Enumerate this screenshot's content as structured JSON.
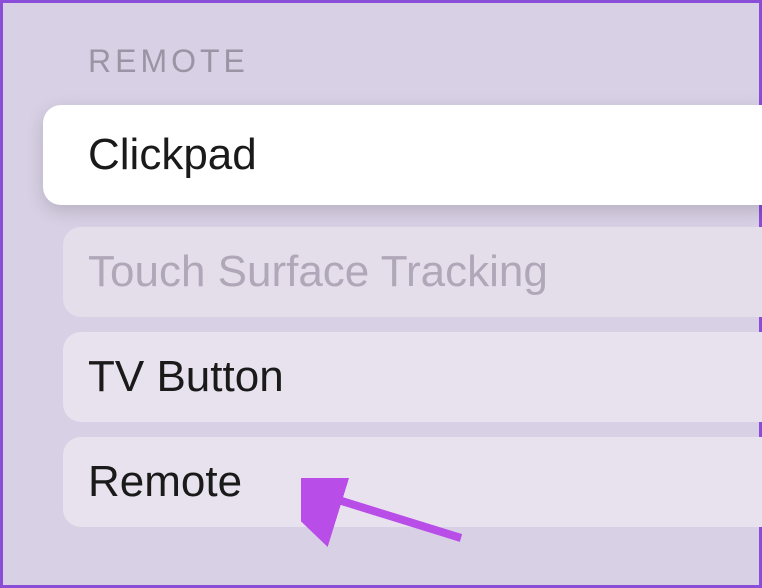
{
  "section": {
    "header": "REMOTE"
  },
  "menu": {
    "items": [
      {
        "label": "Clickpad"
      },
      {
        "label": "Touch Surface Tracking"
      },
      {
        "label": "TV Button"
      },
      {
        "label": "Remote"
      }
    ]
  },
  "annotation": {
    "arrow_color": "#b84de8"
  }
}
